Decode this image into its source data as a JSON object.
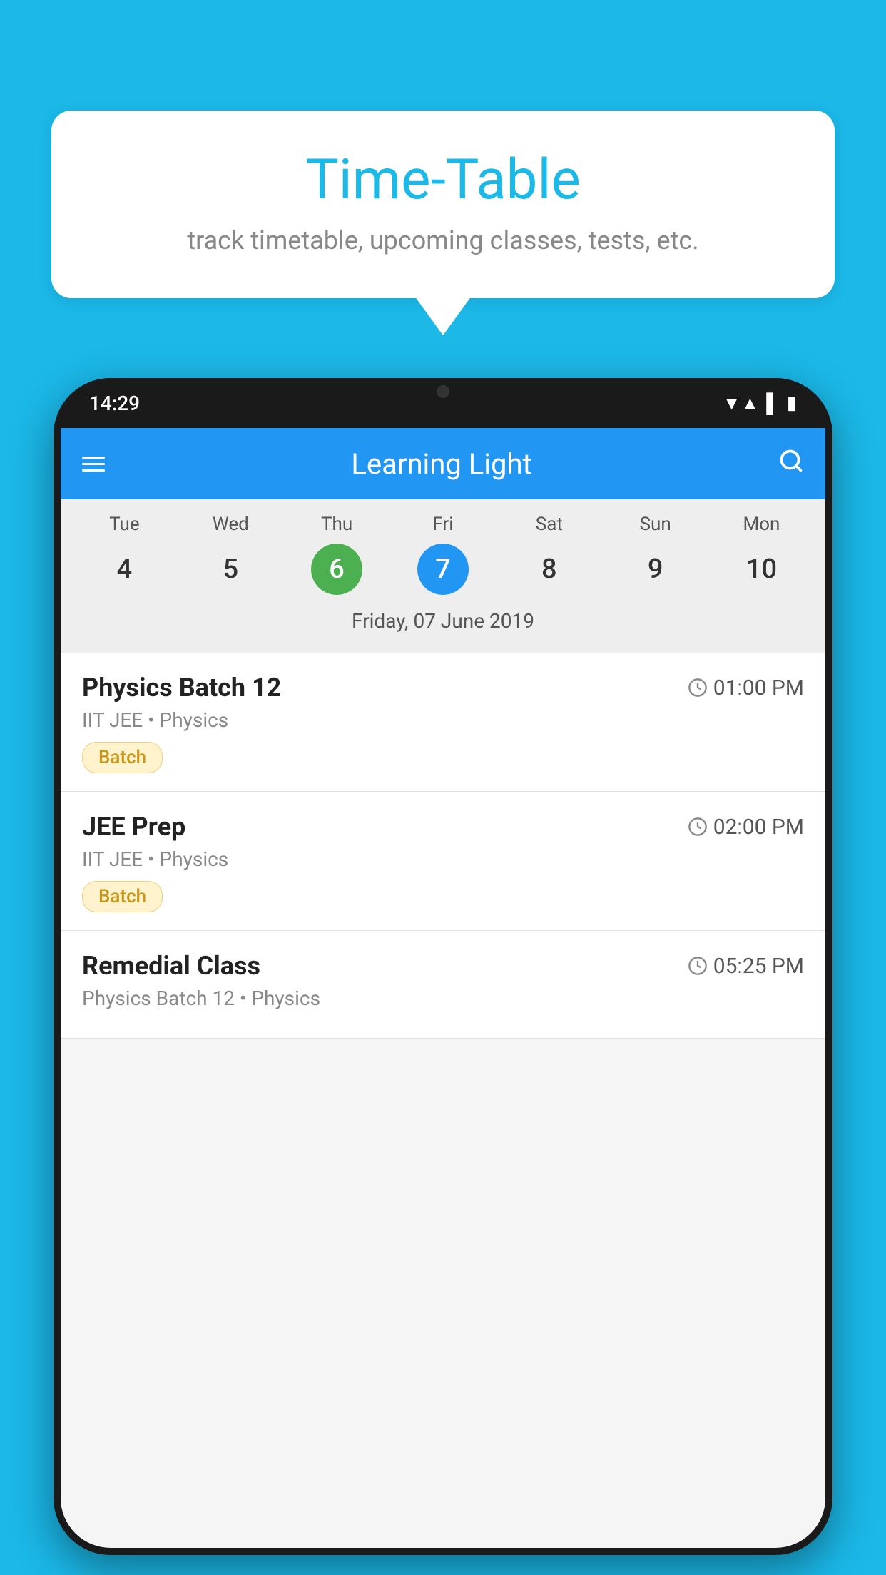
{
  "background_color": "#1BB8E8",
  "speech_bubble": {
    "title": "Time-Table",
    "subtitle": "track timetable, upcoming classes, tests, etc."
  },
  "phone": {
    "status_bar": {
      "time": "14:29"
    },
    "app_header": {
      "title": "Learning Light"
    },
    "calendar": {
      "days": [
        {
          "name": "Tue",
          "num": "4",
          "state": "normal"
        },
        {
          "name": "Wed",
          "num": "5",
          "state": "normal"
        },
        {
          "name": "Thu",
          "num": "6",
          "state": "today"
        },
        {
          "name": "Fri",
          "num": "7",
          "state": "selected"
        },
        {
          "name": "Sat",
          "num": "8",
          "state": "normal"
        },
        {
          "name": "Sun",
          "num": "9",
          "state": "normal"
        },
        {
          "name": "Mon",
          "num": "10",
          "state": "normal"
        }
      ],
      "selected_date_label": "Friday, 07 June 2019"
    },
    "schedule": [
      {
        "title": "Physics Batch 12",
        "time": "01:00 PM",
        "subtitle": "IIT JEE • Physics",
        "badge": "Batch"
      },
      {
        "title": "JEE Prep",
        "time": "02:00 PM",
        "subtitle": "IIT JEE • Physics",
        "badge": "Batch"
      },
      {
        "title": "Remedial Class",
        "time": "05:25 PM",
        "subtitle": "Physics Batch 12 • Physics",
        "badge": null
      }
    ]
  }
}
